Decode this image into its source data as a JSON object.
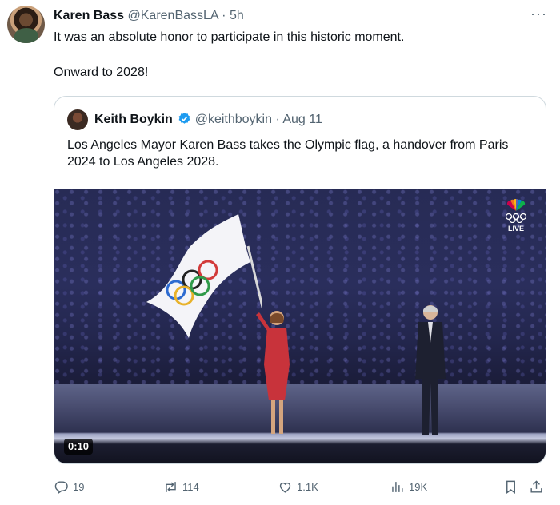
{
  "post": {
    "author_name": "Karen Bass",
    "handle": "@KarenBassLA",
    "separator": "·",
    "time": "5h",
    "more_icon": "more-dots-icon",
    "text_line1": "It was an absolute honor to participate in this historic moment.",
    "text_line2": "Onward to 2028!"
  },
  "quote": {
    "author_name": "Keith Boykin",
    "verified_icon": "verified-badge-icon",
    "handle": "@keithboykin",
    "separator": "·",
    "date": "Aug 11",
    "text": "Los Angeles Mayor Karen Bass takes the Olympic flag, a handover from Paris 2024 to Los Angeles 2028.",
    "media": {
      "network_badge": "LIVE",
      "duration": "0:10"
    }
  },
  "actions": {
    "replies": "19",
    "reposts": "114",
    "likes": "1.1K",
    "views": "19K"
  },
  "colors": {
    "text": "#0f1419",
    "muted": "#536471",
    "border": "#cfd9de",
    "verified": "#1d9bf0"
  }
}
